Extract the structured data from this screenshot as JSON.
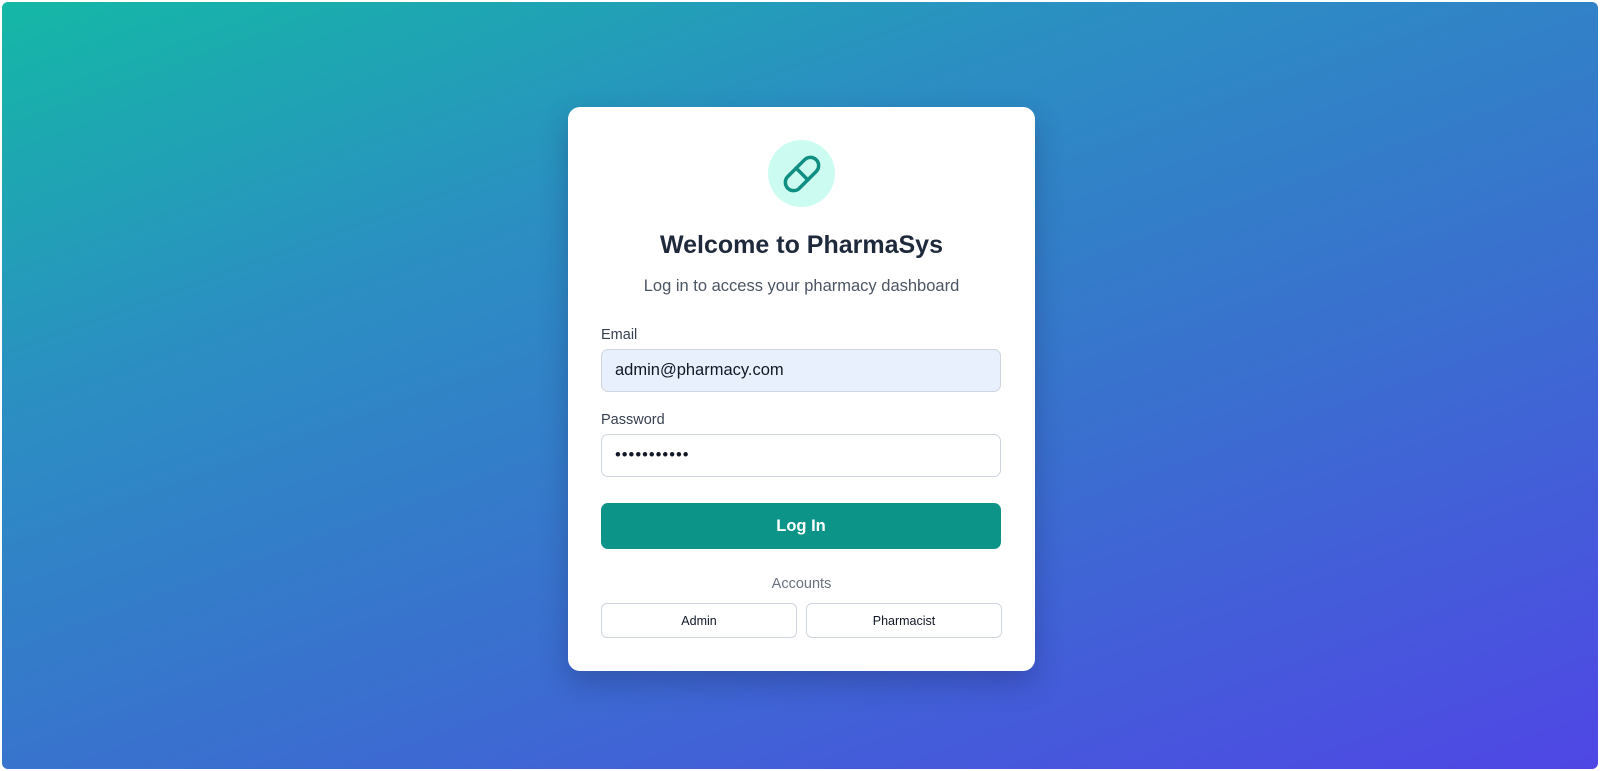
{
  "app": {
    "title": "Welcome to PharmaSys",
    "subtitle": "Log in to access your pharmacy dashboard",
    "logo_icon": "pill-icon",
    "accent_color": "#0d9488"
  },
  "form": {
    "email_label": "Email",
    "email_value": "admin@pharmacy.com",
    "password_label": "Password",
    "password_value": "password123",
    "submit_label": "Log In"
  },
  "accounts": {
    "label": "Accounts",
    "options": [
      {
        "label": "Admin"
      },
      {
        "label": "Pharmacist"
      }
    ]
  }
}
